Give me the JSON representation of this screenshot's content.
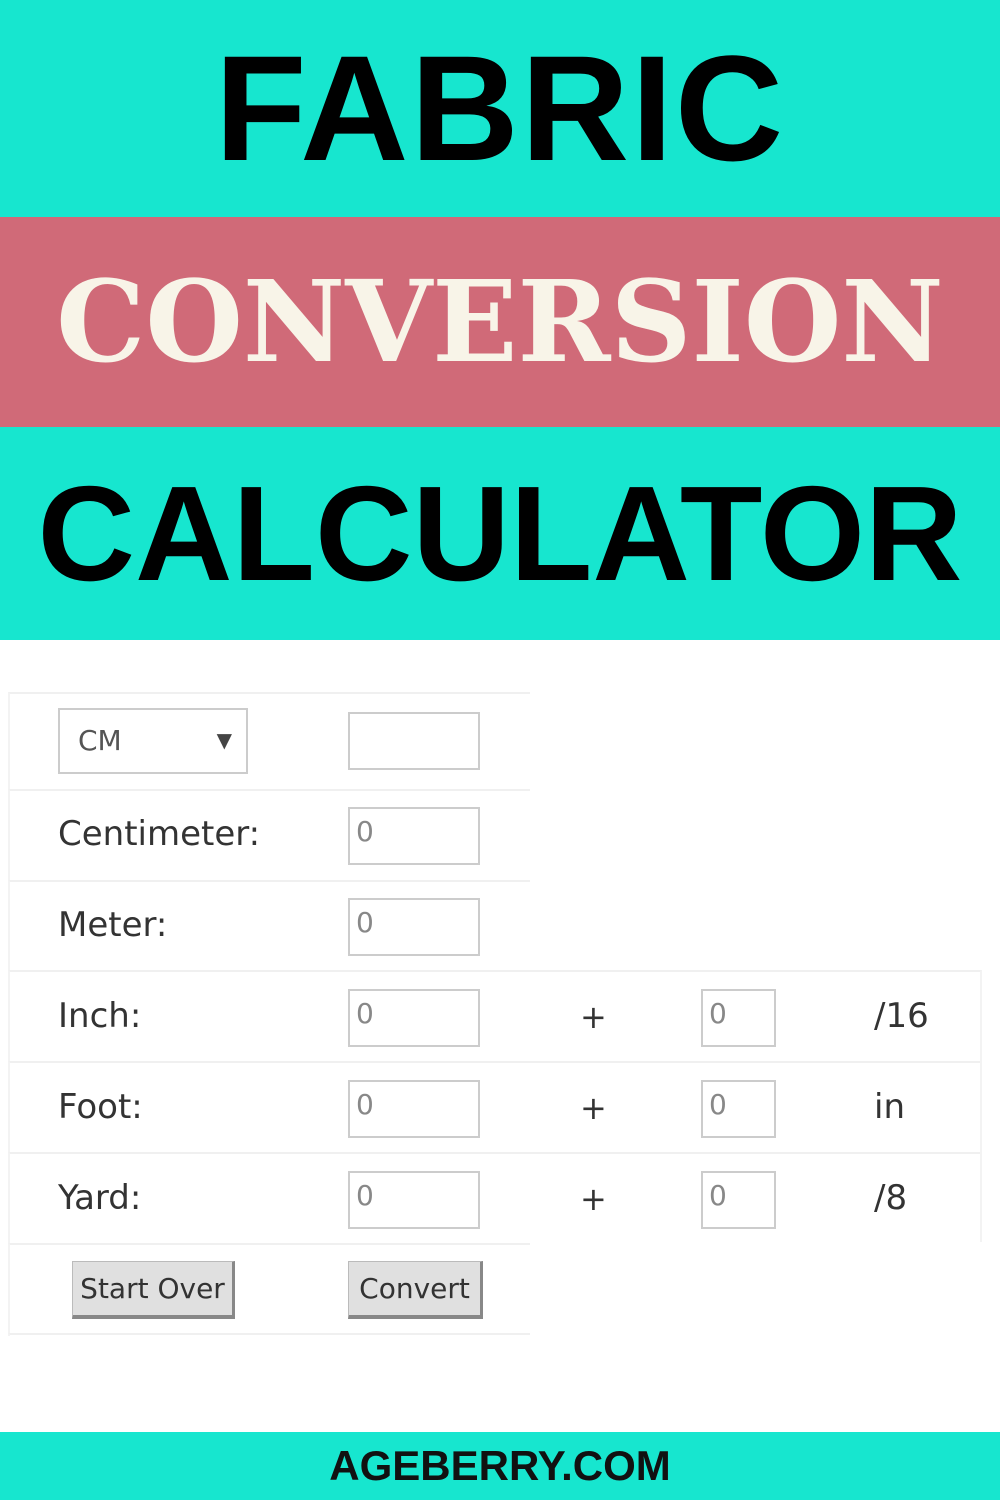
{
  "banner": {
    "line1": "FABRIC",
    "line2": "CONVERSION",
    "line3": "CALCULATOR",
    "footer": "AGEBERRY.COM"
  },
  "colors": {
    "teal": "#17E6CF",
    "pink": "#D06A78"
  },
  "calculator": {
    "unit_select": {
      "value": "CM",
      "icon": "dropdown-arrow-icon"
    },
    "input_value": "",
    "rows": [
      {
        "label": "Centimeter:",
        "value": "0"
      },
      {
        "label": "Meter:",
        "value": "0"
      },
      {
        "label": "Inch:",
        "value": "0",
        "plus": "+",
        "fraction": "0",
        "suffix": "/16"
      },
      {
        "label": "Foot:",
        "value": "0",
        "plus": "+",
        "fraction": "0",
        "suffix": "in"
      },
      {
        "label": "Yard:",
        "value": "0",
        "plus": "+",
        "fraction": "0",
        "suffix": "/8"
      }
    ],
    "start_over_label": "Start Over",
    "convert_label": "Convert"
  }
}
